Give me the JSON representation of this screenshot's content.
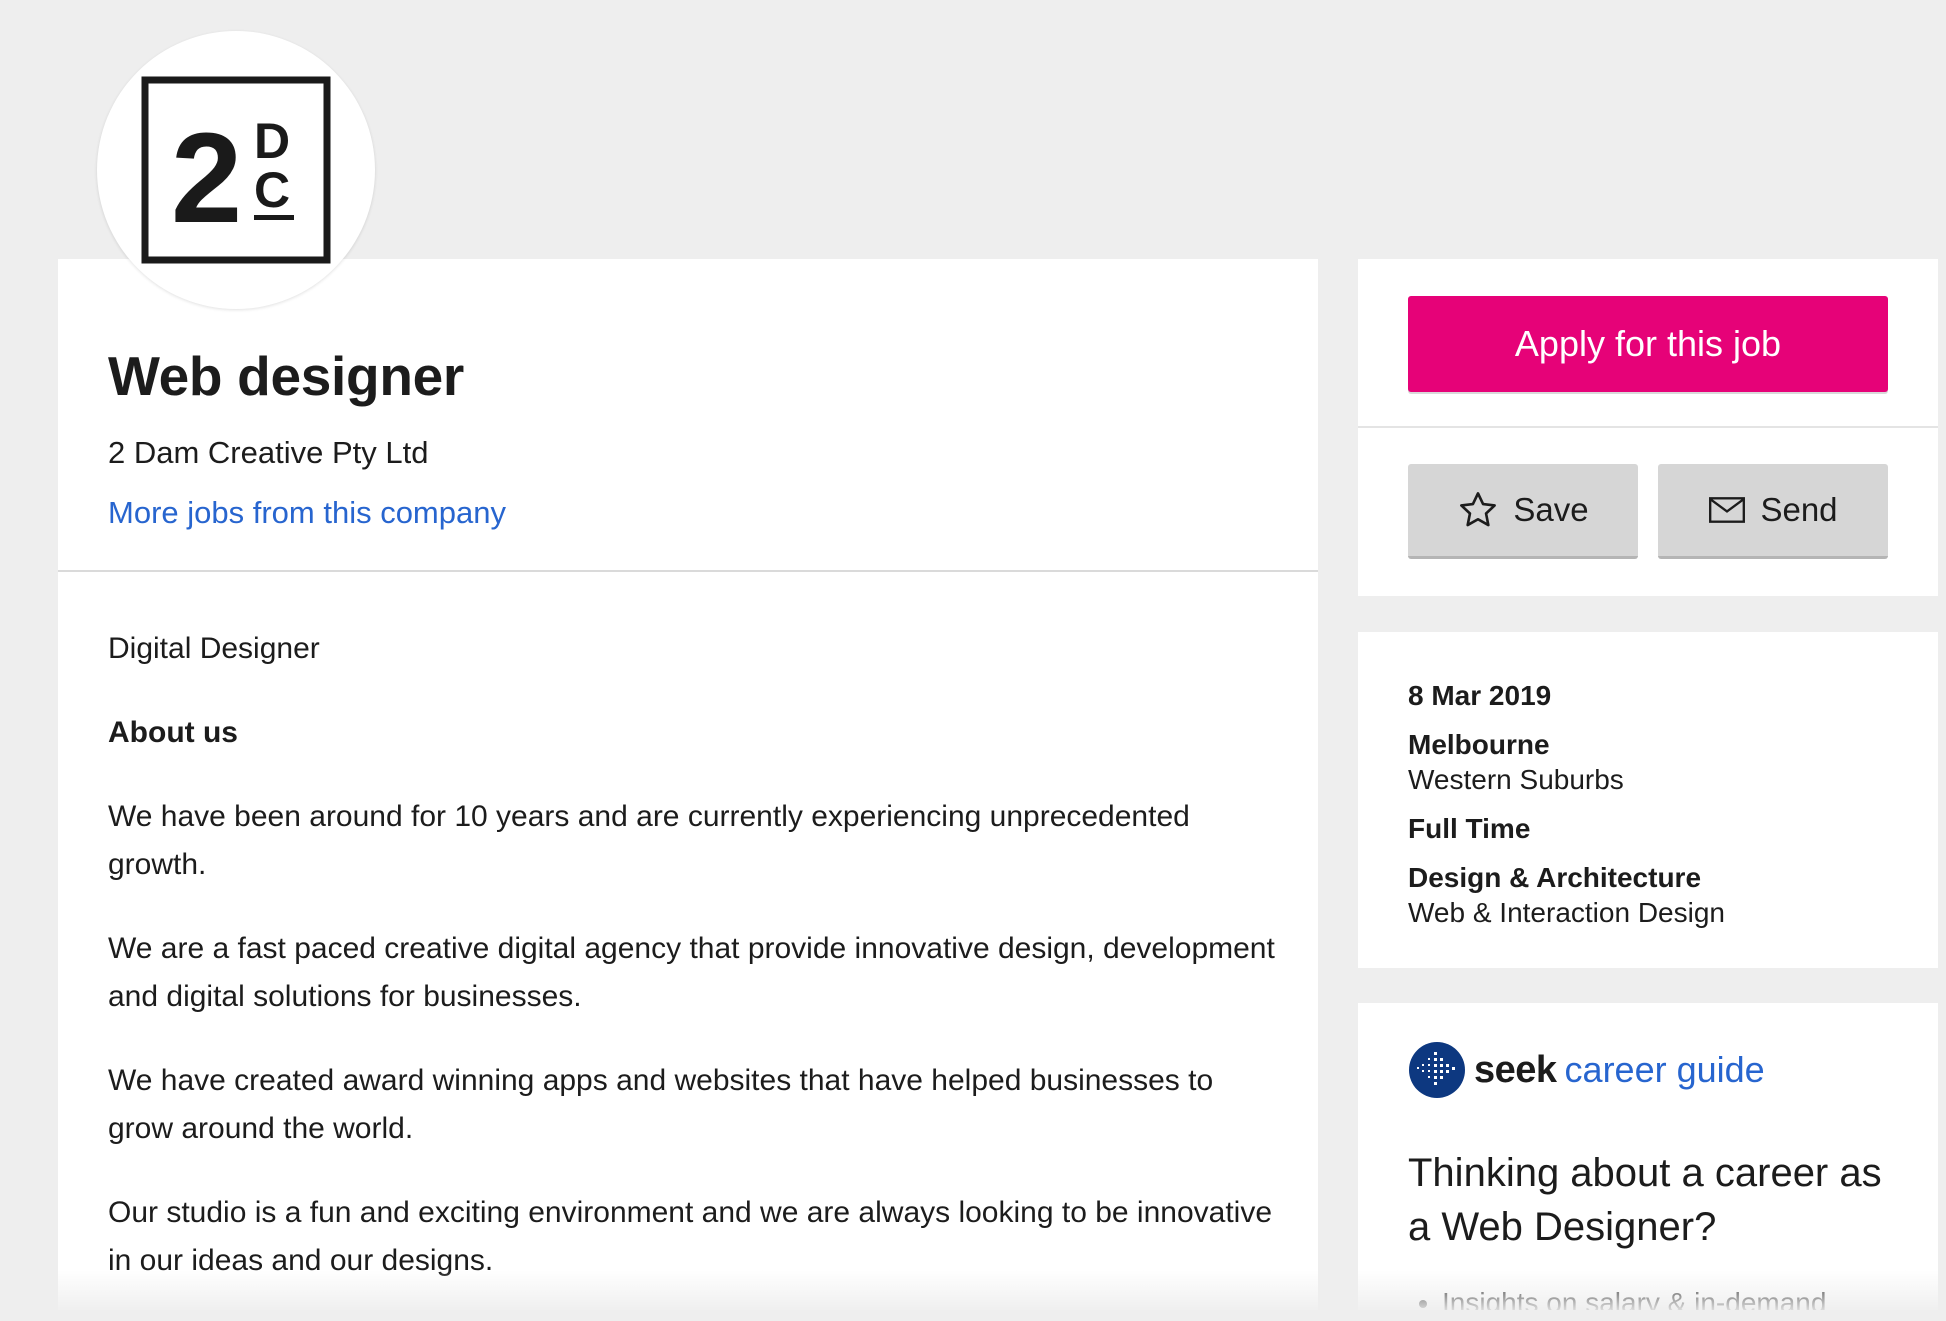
{
  "company_logo": {
    "big_char": "2",
    "top_char": "D",
    "bottom_char": "C"
  },
  "job": {
    "title": "Web designer",
    "company": "2 Dam Creative Pty Ltd",
    "more_jobs_link": "More jobs from this company"
  },
  "description": {
    "subtitle": "Digital Designer",
    "heading": "About us",
    "paragraphs": [
      "We have been around for 10 years and are currently experiencing unprecedented growth.",
      "We are a fast paced creative digital agency that provide innovative design, development and digital solutions for businesses.",
      "We have created award winning apps and websites that have helped businesses to grow around the world.",
      "Our studio is a fun and exciting environment and we are always looking to be innovative in our ideas and our designs."
    ]
  },
  "actions": {
    "apply_label": "Apply for this job",
    "save_label": "Save",
    "send_label": "Send"
  },
  "details": {
    "date": "8 Mar 2019",
    "location": "Melbourne",
    "area": "Western Suburbs",
    "work_type": "Full Time",
    "classification": "Design & Architecture",
    "sub_classification": "Web & Interaction Design"
  },
  "career_guide": {
    "brand": "seek",
    "guide_label": "career guide",
    "heading": "Thinking about a career as a Web Designer?",
    "items": [
      "Insights on salary & in-demand"
    ]
  },
  "colors": {
    "apply_button": "#e60278",
    "link": "#2765cf",
    "seek_logo": "#0d3880"
  },
  "icons": {
    "save": "star-icon",
    "send": "envelope-icon",
    "seek": "seek-logo-icon"
  }
}
